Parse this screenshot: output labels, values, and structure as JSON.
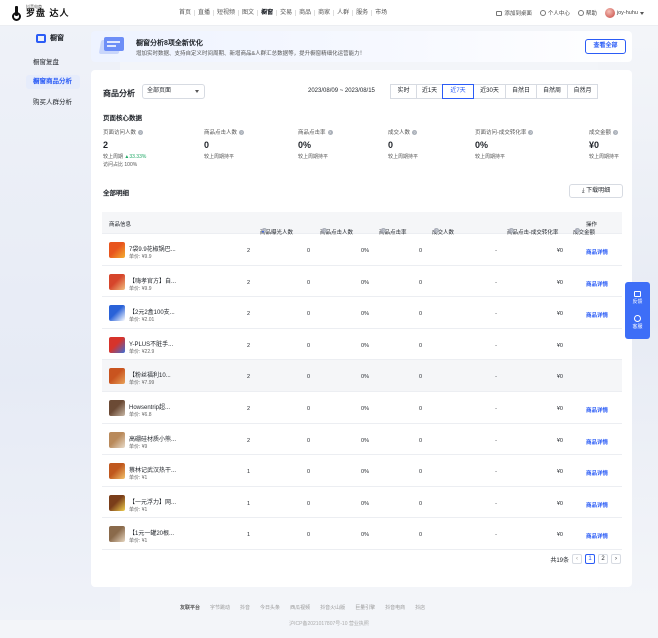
{
  "brand": {
    "small": "抖音电商",
    "big": "罗盘 达人"
  },
  "nav": [
    "首页",
    "直播",
    "短视频",
    "图文",
    "橱窗",
    "交易",
    "商品",
    "商家",
    "人群",
    "服务",
    "市场"
  ],
  "nav_active": "橱窗",
  "top_right": {
    "add_desktop": "添加到桌面",
    "personal": "个人中心",
    "help": "帮助",
    "user": "joy-huhu"
  },
  "sidebar": {
    "title": "橱窗",
    "items": [
      {
        "label": "橱窗复盘",
        "active": false
      },
      {
        "label": "橱窗商品分析",
        "active": true
      },
      {
        "label": "购买人群分析",
        "active": false
      }
    ]
  },
  "banner": {
    "title": "橱窗分析8项全新优化",
    "desc": "增加实时数据、支持自定义时间周期、新增商品&人群汇总数据等，提升橱窗精细化运营能力！",
    "button": "查看全部"
  },
  "panel": {
    "title": "商品分析",
    "select": "全部页面",
    "date_range": "2023/08/09 ~ 2023/08/15",
    "tabs": [
      "实时",
      "近1天",
      "近7天",
      "近30天",
      "自然日",
      "自然周",
      "自然月"
    ],
    "active_tab": "近7天",
    "core_title": "页面核心数据",
    "metrics": [
      {
        "label": "页面访问人数",
        "value": "2",
        "compare": "较上周期",
        "delta": "33.33%",
        "extra": "访问占比 100%"
      },
      {
        "label": "商品点击人数",
        "value": "0",
        "compare": "较上周期持平"
      },
      {
        "label": "商品点击率",
        "value": "0%",
        "compare": "较上周期持平"
      },
      {
        "label": "成交人数",
        "value": "0",
        "compare": "较上周期持平"
      },
      {
        "label": "页面访问-成交转化率",
        "value": "0%",
        "compare": "较上周期持平"
      },
      {
        "label": "成交金额",
        "value": "¥0",
        "compare": "较上周期持平"
      }
    ],
    "detail_title": "全部明细",
    "download": "下载明细"
  },
  "table": {
    "headers": [
      "商品信息",
      "商品曝光人数",
      "商品点击人数",
      "商品点击率",
      "成交人数",
      "商品点击-成交转化率",
      "成交金额",
      "操作"
    ],
    "op_label": "商品详情",
    "rows": [
      {
        "name": "7袋9.9花椒锅巴...",
        "price": "单价: ¥9.9",
        "c1": "2",
        "c2": "0",
        "c3": "0%",
        "c4": "0",
        "c5": "-",
        "c6": "¥0",
        "op": true,
        "thumb": [
          "#e8551d",
          "#f3b033"
        ]
      },
      {
        "name": "【嗨孝官方】自...",
        "price": "单价: ¥9.9",
        "c1": "2",
        "c2": "0",
        "c3": "0%",
        "c4": "0",
        "c5": "-",
        "c6": "¥0",
        "op": true,
        "thumb": [
          "#d6452b",
          "#f0c080"
        ]
      },
      {
        "name": "【2元2盒100支...",
        "price": "单价: ¥2.01",
        "c1": "2",
        "c2": "0",
        "c3": "0%",
        "c4": "0",
        "c5": "-",
        "c6": "¥0",
        "op": true,
        "thumb": [
          "#2a62d8",
          "#ffffff"
        ]
      },
      {
        "name": "Y-PLUS不脏手...",
        "price": "单价: ¥22.9",
        "c1": "2",
        "c2": "0",
        "c3": "0%",
        "c4": "0",
        "c5": "-",
        "c6": "¥0",
        "op": false,
        "thumb": [
          "#d7332b",
          "#3b6fd8"
        ]
      },
      {
        "name": "【粉丝福利10...",
        "price": "单价: ¥7.99",
        "c1": "2",
        "c2": "0",
        "c3": "0%",
        "c4": "0",
        "c5": "-",
        "c6": "¥0",
        "op": false,
        "thumb": [
          "#c9541f",
          "#e8a25a"
        ],
        "hl": true
      },
      {
        "name": "Howsentrip超...",
        "price": "单价: ¥6.8",
        "c1": "2",
        "c2": "0",
        "c3": "0%",
        "c4": "0",
        "c5": "-",
        "c6": "¥0",
        "op": true,
        "thumb": [
          "#6b4a35",
          "#c8b8a6"
        ]
      },
      {
        "name": "高硼硅材质小熊...",
        "price": "单价: ¥9",
        "c1": "2",
        "c2": "0",
        "c3": "0%",
        "c4": "0",
        "c5": "-",
        "c6": "¥0",
        "op": true,
        "thumb": [
          "#b98a5b",
          "#e8dccb"
        ]
      },
      {
        "name": "蔡林记武汉热干...",
        "price": "单价: ¥1",
        "c1": "1",
        "c2": "0",
        "c3": "0%",
        "c4": "0",
        "c5": "-",
        "c6": "¥0",
        "op": true,
        "thumb": [
          "#c0581e",
          "#f2c36d"
        ]
      },
      {
        "name": "【一元浮力】网...",
        "price": "单价: ¥1",
        "c1": "1",
        "c2": "0",
        "c3": "0%",
        "c4": "0",
        "c5": "-",
        "c6": "¥0",
        "op": true,
        "thumb": [
          "#7a3e1a",
          "#f0d04d"
        ]
      },
      {
        "name": "【1元一罐20根...",
        "price": "单价: ¥1",
        "c1": "1",
        "c2": "0",
        "c3": "0%",
        "c4": "0",
        "c5": "-",
        "c6": "¥0",
        "op": true,
        "thumb": [
          "#8a6a4b",
          "#e6d6c0"
        ]
      }
    ]
  },
  "pager": {
    "total": "共19条",
    "pages": [
      "1",
      "2"
    ],
    "current": "1"
  },
  "float": {
    "feedback": "反馈",
    "service": "客服"
  },
  "footer": {
    "links": [
      "友联平台",
      "字节跳动",
      "抖音",
      "今日头条",
      "西瓜视频",
      "抖音火山版",
      "巨量引擎",
      "抖音电商",
      "抖店"
    ],
    "icp": "沪ICP备2021017807号-10  营业执照"
  },
  "colors": {
    "accent": "#2b5cf6",
    "up": "#1fa866",
    "float": "#3d6ef7"
  }
}
